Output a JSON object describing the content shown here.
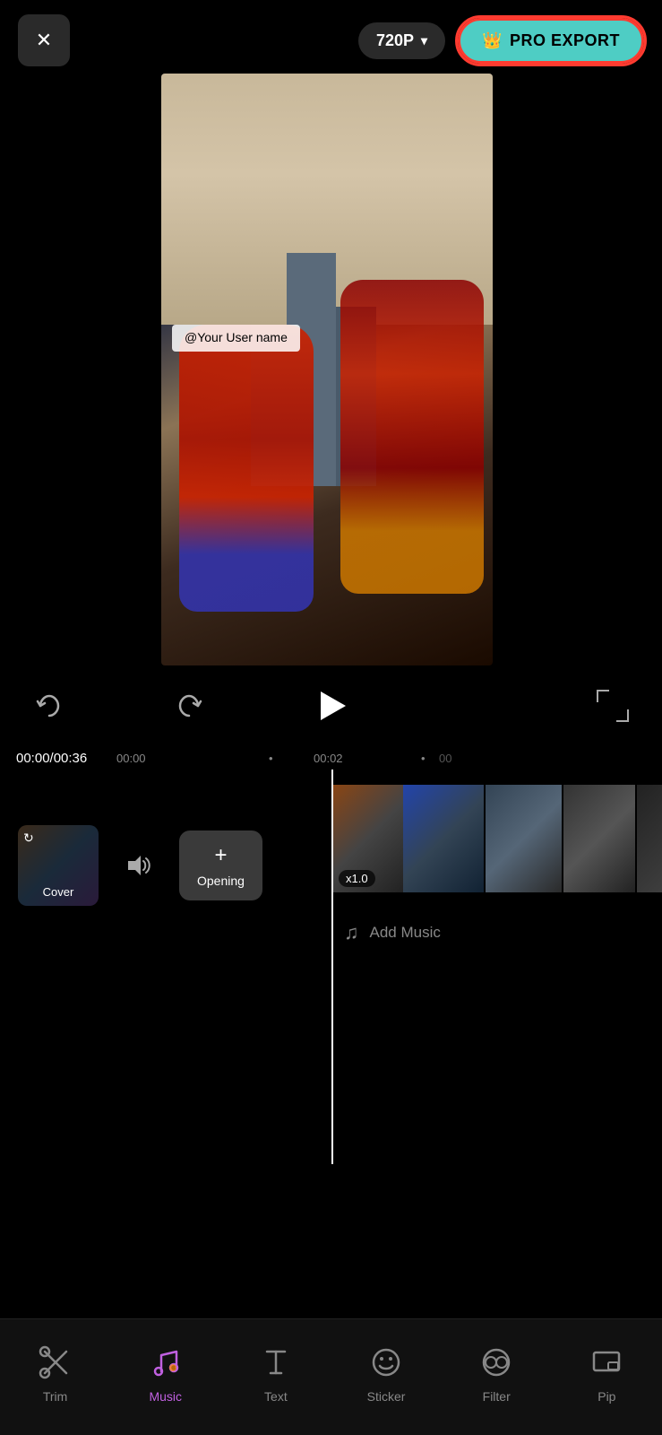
{
  "header": {
    "close_label": "×",
    "quality_label": "720P",
    "quality_chevron": "▾",
    "pro_export_label": "PRO EXPORT",
    "pro_export_icon": "👑"
  },
  "video": {
    "username_overlay": "@Your User name"
  },
  "playback": {
    "current_time": "00:00",
    "total_time": "00:36",
    "time_display": "00:00/00:36"
  },
  "timeline": {
    "markers": [
      "00:00",
      "00:02"
    ],
    "marker_positions": [
      330,
      510
    ]
  },
  "track": {
    "cover_label": "Cover",
    "opening_plus": "+",
    "opening_label": "Opening",
    "speed_badge": "x1.0",
    "add_clip_label": "+",
    "add_music_text": "Add Music"
  },
  "toolbar": {
    "items": [
      {
        "id": "trim",
        "label": "Trim",
        "icon": "scissors"
      },
      {
        "id": "music",
        "label": "Music",
        "icon": "music",
        "active": true
      },
      {
        "id": "text",
        "label": "Text",
        "icon": "text"
      },
      {
        "id": "sticker",
        "label": "Sticker",
        "icon": "sticker"
      },
      {
        "id": "filter",
        "label": "Filter",
        "icon": "filter"
      },
      {
        "id": "pip",
        "label": "Pip",
        "icon": "pip"
      }
    ]
  },
  "colors": {
    "pro_export_bg": "#4ECDC4",
    "pro_export_border": "#ff3b30",
    "active_tool": "#c060e0",
    "background": "#000000",
    "toolbar_bg": "#111111"
  }
}
